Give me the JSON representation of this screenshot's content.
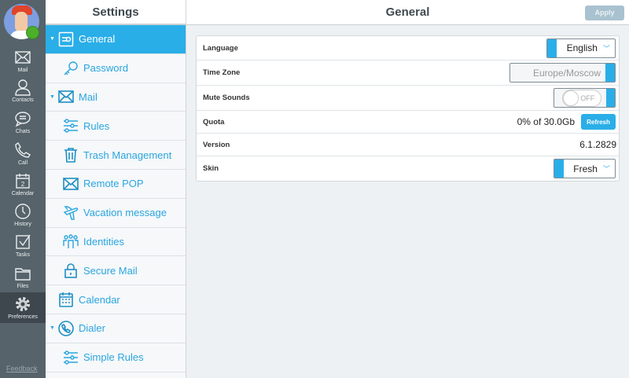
{
  "rail": {
    "items": [
      {
        "label": "Mail",
        "icon": "mail-icon"
      },
      {
        "label": "Contacts",
        "icon": "contacts-icon"
      },
      {
        "label": "Chats",
        "icon": "chat-icon"
      },
      {
        "label": "Call",
        "icon": "phone-icon"
      },
      {
        "label": "Calendar",
        "icon": "calendar-icon",
        "badge": "2"
      },
      {
        "label": "History",
        "icon": "clock-icon"
      },
      {
        "label": "Tasks",
        "icon": "tasks-icon"
      },
      {
        "label": "Files",
        "icon": "folder-icon"
      },
      {
        "label": "Preferences",
        "icon": "gear-icon",
        "active": true
      }
    ],
    "feedback": "Feedback",
    "status_color": "#4caf2a"
  },
  "settings": {
    "title": "Settings",
    "items": [
      {
        "label": "General",
        "icon": "general-icon",
        "selected": true
      },
      {
        "label": "Password",
        "icon": "key-icon"
      },
      {
        "label": "Mail",
        "icon": "mail-icon"
      },
      {
        "label": "Rules",
        "icon": "sliders-icon"
      },
      {
        "label": "Trash Management",
        "icon": "trash-icon"
      },
      {
        "label": "Remote POP",
        "icon": "mail-icon"
      },
      {
        "label": "Vacation message",
        "icon": "airplane-icon"
      },
      {
        "label": "Identities",
        "icon": "identities-icon"
      },
      {
        "label": "Secure Mail",
        "icon": "lock-icon"
      },
      {
        "label": "Calendar",
        "icon": "calendar-icon"
      },
      {
        "label": "Dialer",
        "icon": "phone-icon"
      },
      {
        "label": "Simple Rules",
        "icon": "sliders-icon"
      }
    ]
  },
  "main": {
    "title": "General",
    "apply": "Apply",
    "rows": {
      "language": {
        "label": "Language",
        "value": "English"
      },
      "timezone": {
        "label": "Time Zone",
        "value": "Europe/Moscow"
      },
      "mute": {
        "label": "Mute Sounds",
        "value": "OFF"
      },
      "quota": {
        "label": "Quota",
        "value": "0% of 30.0Gb",
        "button": "Refresh"
      },
      "version": {
        "label": "Version",
        "value": "6.1.2829"
      },
      "skin": {
        "label": "Skin",
        "value": "Fresh"
      }
    }
  },
  "colors": {
    "accent": "#2aaee8",
    "rail": "#56636a"
  }
}
